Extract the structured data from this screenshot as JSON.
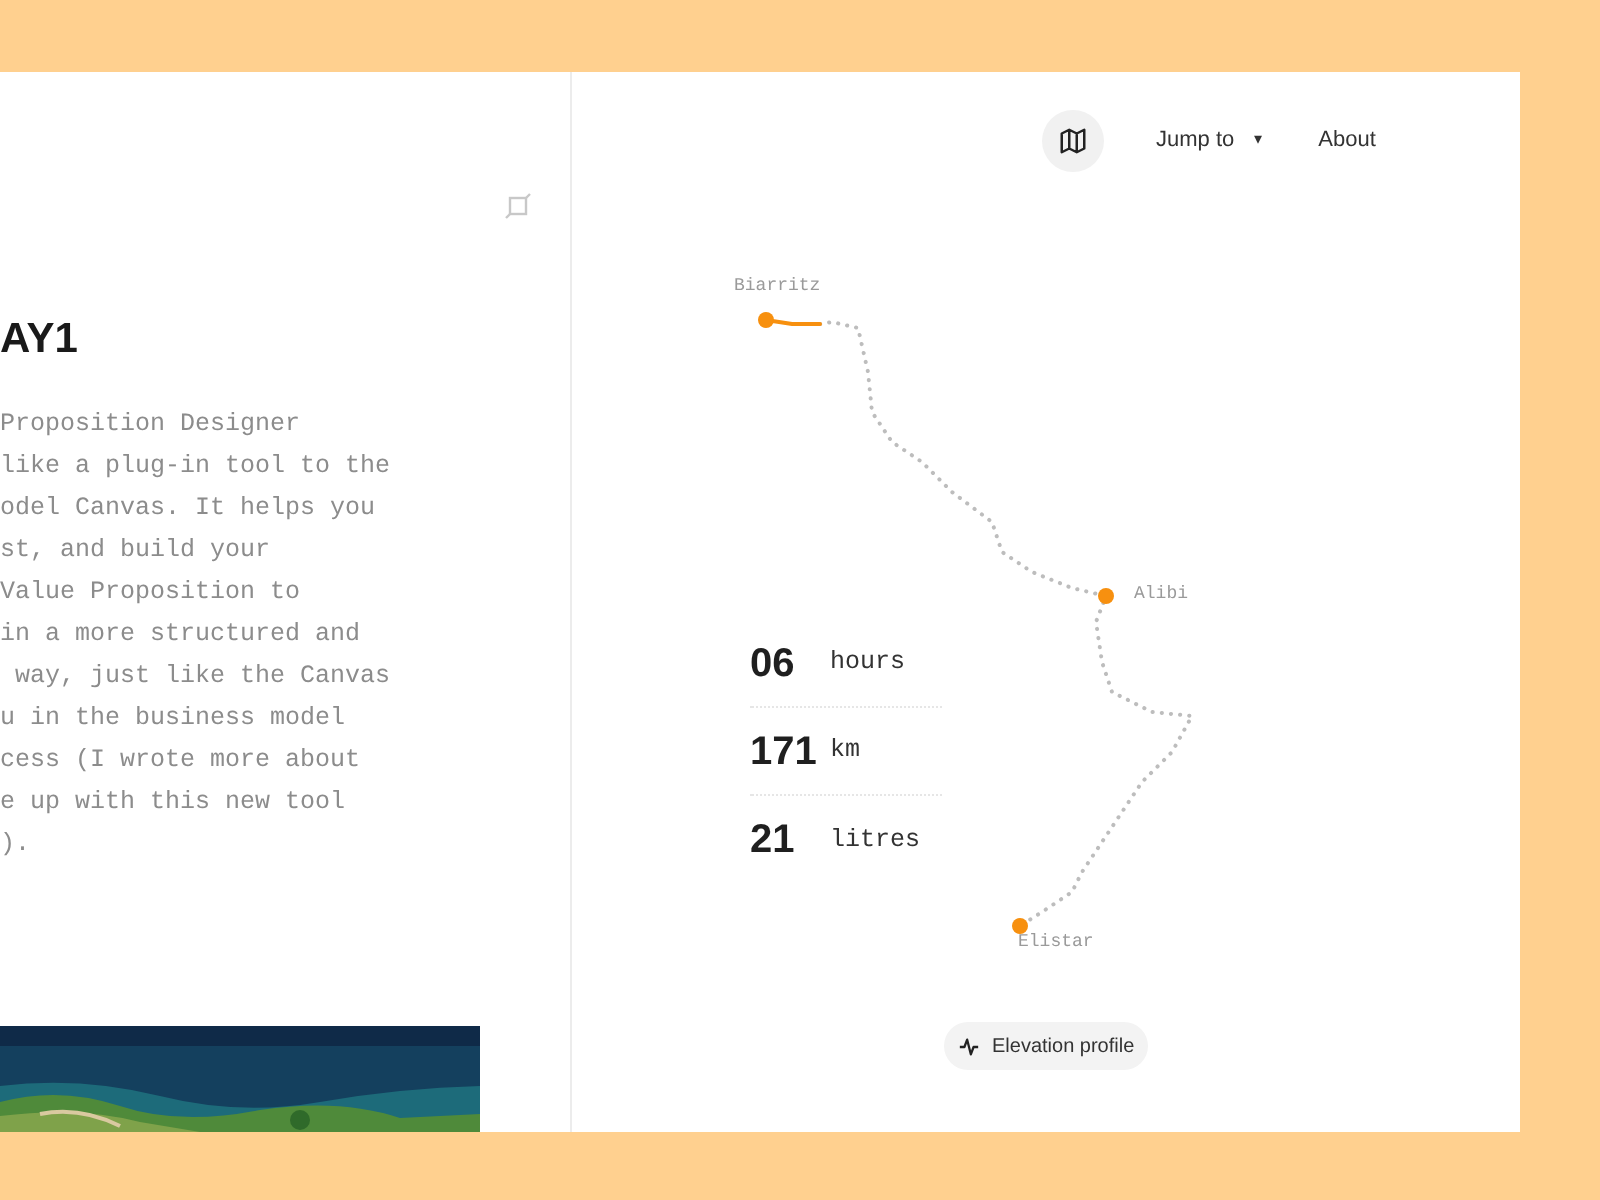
{
  "article": {
    "heading": "AY1",
    "lines": [
      "Proposition Designer",
      "like a plug-in tool to the",
      "odel Canvas. It helps you",
      "st, and build your",
      "Value Proposition to",
      "in a more structured and",
      " way, just like the Canvas",
      "u in the business model",
      "cess (I wrote more about",
      "e up with this new tool",
      ")."
    ]
  },
  "nav": {
    "jump_to": "Jump to",
    "caret": "▾",
    "about": "About"
  },
  "route": {
    "stops": [
      {
        "name": "Biarritz"
      },
      {
        "name": "Alibi"
      },
      {
        "name": "Elistar"
      }
    ]
  },
  "stats": [
    {
      "value": "06",
      "unit": "hours"
    },
    {
      "value": "171",
      "unit": "km"
    },
    {
      "value": "21",
      "unit": "litres"
    }
  ],
  "elevation_button": "Elevation profile"
}
